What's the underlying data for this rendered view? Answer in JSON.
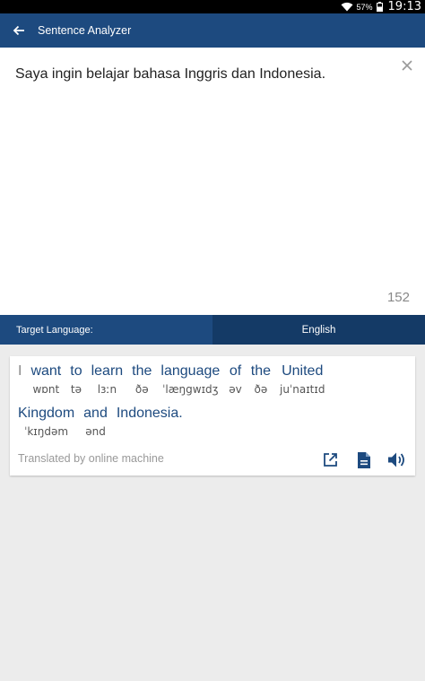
{
  "status_bar": {
    "battery_percent": "57%",
    "time": "19:13",
    "icons": [
      "wifi-icon",
      "battery-icon"
    ]
  },
  "app_bar": {
    "title": "Sentence Analyzer",
    "back_icon": "arrow-left-icon"
  },
  "input": {
    "text": "Saya ingin belajar bahasa Inggris dan Indonesia.",
    "char_count": "152",
    "clear_icon": "close-icon"
  },
  "language_bar": {
    "label": "Target Language:",
    "selected": "English"
  },
  "result": {
    "lines": [
      [
        {
          "word": "I",
          "ipa": "",
          "linked": false
        },
        {
          "word": "want",
          "ipa": "wɒnt",
          "linked": true
        },
        {
          "word": "to",
          "ipa": "tə",
          "linked": true
        },
        {
          "word": "learn",
          "ipa": "lɜːn",
          "linked": true
        },
        {
          "word": "the",
          "ipa": "ðə",
          "linked": true
        },
        {
          "word": "language",
          "ipa": "ˈlæŋgwɪdʒ",
          "linked": true
        },
        {
          "word": "of",
          "ipa": "əv",
          "linked": true
        },
        {
          "word": "the",
          "ipa": "ðə",
          "linked": true
        },
        {
          "word": "United",
          "ipa": "juˈnaɪtɪd",
          "linked": true
        }
      ],
      [
        {
          "word": "Kingdom",
          "ipa": "ˈkɪŋdəm",
          "linked": true
        },
        {
          "word": "and",
          "ipa": "ənd",
          "linked": true
        },
        {
          "word": "Indonesia.",
          "ipa": "",
          "linked": true
        }
      ]
    ],
    "translated_by": "Translated by online machine",
    "actions": [
      "open-external-icon",
      "document-icon",
      "speaker-icon"
    ]
  },
  "colors": {
    "primary": "#1d4a7f",
    "primary_dark": "#143a66",
    "background": "#ececec"
  }
}
